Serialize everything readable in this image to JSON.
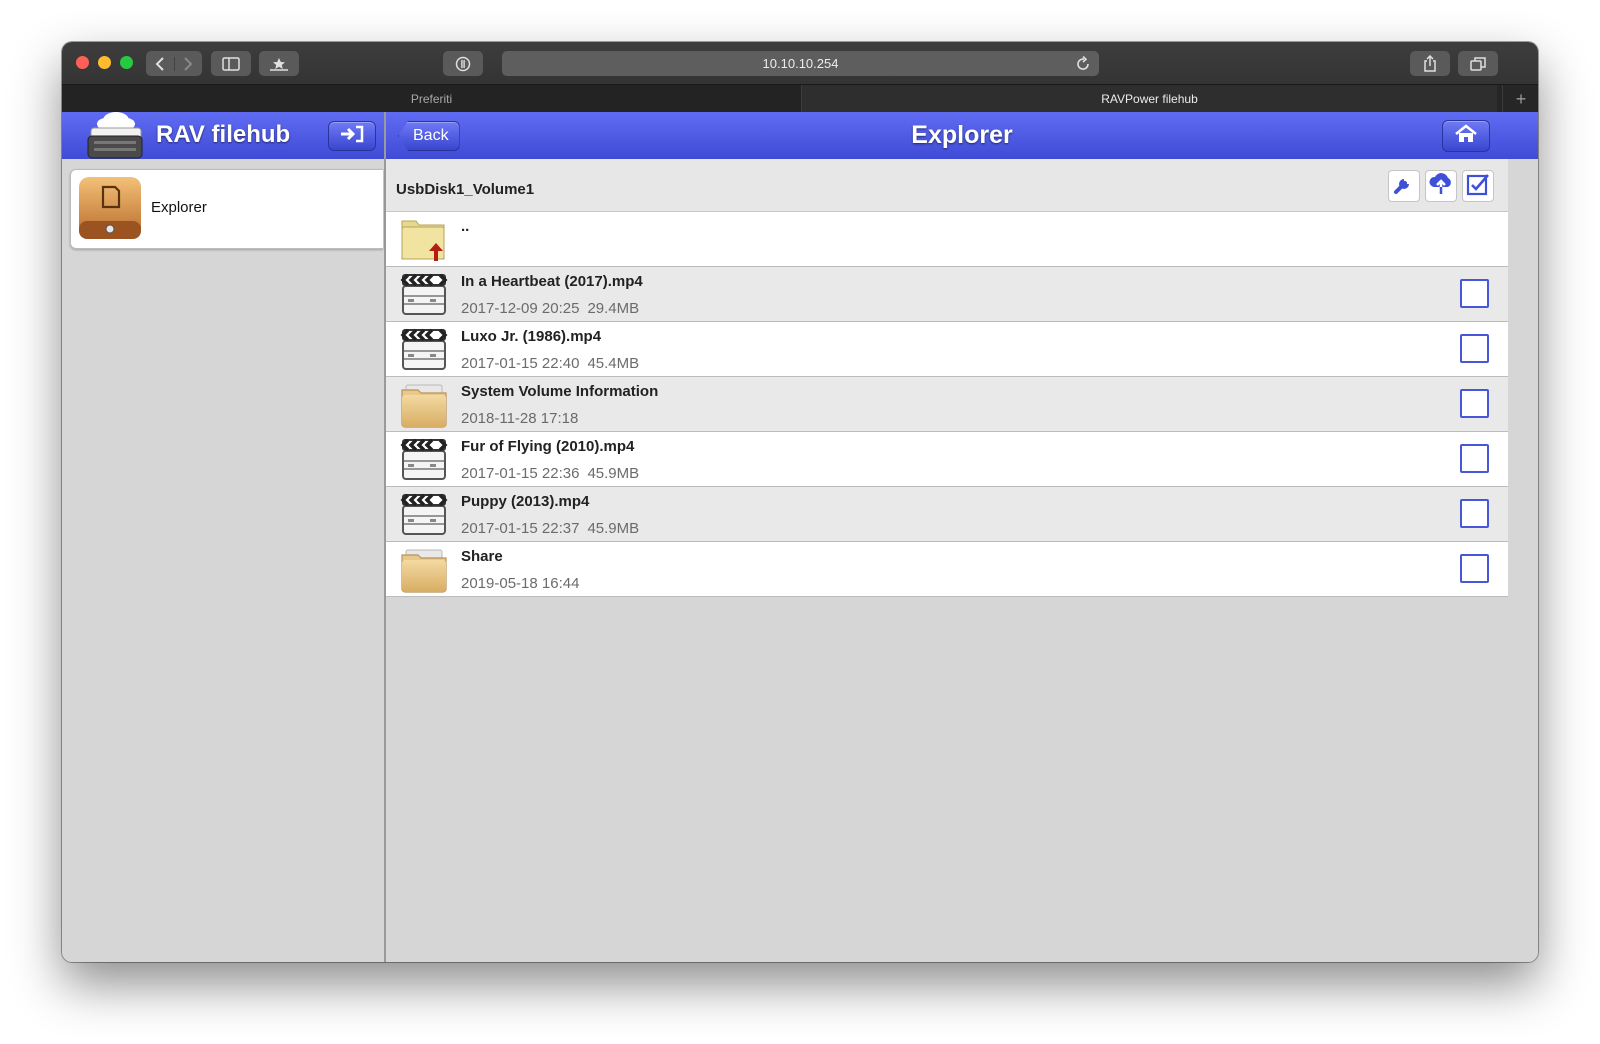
{
  "browser": {
    "url": "10.10.10.254",
    "tabs": [
      {
        "label": "Preferiti"
      },
      {
        "label": "RAVPower filehub"
      }
    ],
    "new_tab_label": "+"
  },
  "app": {
    "title": "RAV filehub",
    "back_label": "Back",
    "page_title": "Explorer",
    "accent_color": "#4b57e3"
  },
  "sidebar": {
    "items": [
      {
        "label": "Explorer",
        "icon": "explorer-icon"
      }
    ]
  },
  "explorer": {
    "path": "UsbDisk1_Volume1",
    "tools": [
      "wrench-icon",
      "cloud-upload-icon",
      "select-all-icon"
    ],
    "parent_label": "..",
    "files": [
      {
        "name": "In a Heartbeat (2017).mp4",
        "date": "2017-12-09 20:25",
        "size": "29.4MB",
        "type": "video"
      },
      {
        "name": "Luxo Jr. (1986).mp4",
        "date": "2017-01-15 22:40",
        "size": "45.4MB",
        "type": "video"
      },
      {
        "name": "System Volume Information",
        "date": "2018-11-28 17:18",
        "size": "",
        "type": "folder"
      },
      {
        "name": "Fur of Flying (2010).mp4",
        "date": "2017-01-15 22:36",
        "size": "45.9MB",
        "type": "video"
      },
      {
        "name": "Puppy (2013).mp4",
        "date": "2017-01-15 22:37",
        "size": "45.9MB",
        "type": "video"
      },
      {
        "name": "Share",
        "date": "2019-05-18 16:44",
        "size": "",
        "type": "folder"
      }
    ]
  }
}
